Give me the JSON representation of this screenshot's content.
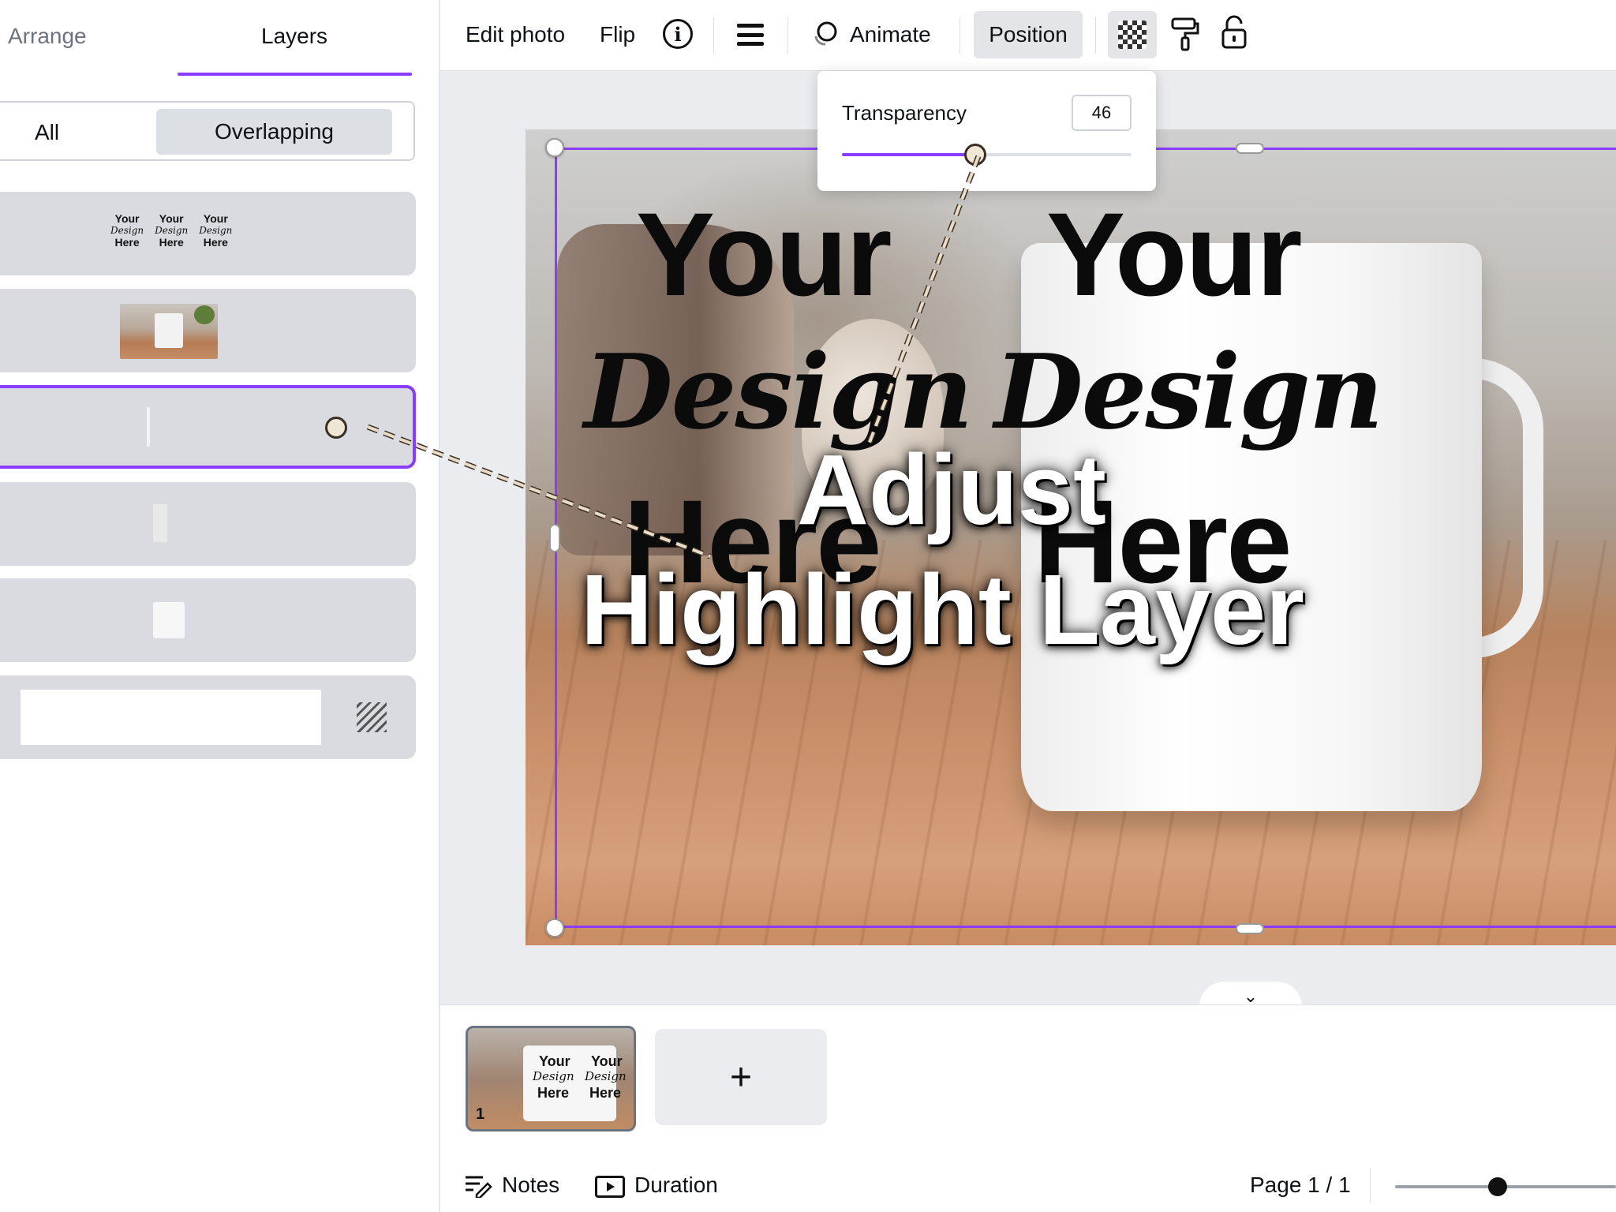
{
  "left_panel": {
    "tabs": [
      {
        "label": "Arrange"
      },
      {
        "label": "Layers"
      }
    ],
    "active_tab": "Layers",
    "filters": [
      {
        "label": "All"
      },
      {
        "label": "Overlapping"
      }
    ],
    "active_filter": "Overlapping",
    "layer_thumb_text": {
      "top": "Your",
      "script": "Design",
      "bottom": "Here"
    }
  },
  "toolbar": {
    "edit_photo": "Edit photo",
    "flip": "Flip",
    "info": "i",
    "animate": "Animate",
    "position": "Position"
  },
  "transparency": {
    "label": "Transparency",
    "value": "46",
    "level_percent": 46
  },
  "canvas": {
    "mug_text": {
      "top": "Your",
      "script": "Design",
      "bottom": "Here"
    },
    "caption_line1": "Adjust",
    "caption_line2": "Highlight Layer"
  },
  "pages": {
    "page_number": "1",
    "add_symbol": "+",
    "thumb_text": {
      "top": "Your",
      "script": "Design",
      "bottom": "Here"
    }
  },
  "footer": {
    "notes": "Notes",
    "duration": "Duration",
    "page_indicator": "Page 1 / 1",
    "collapse_symbol": "⌄"
  },
  "icons": {
    "info": "info-icon",
    "position_menu": "lines-icon",
    "animate": "animate-icon",
    "transparency": "checkerboard-icon",
    "copy_style": "paint-roller-icon",
    "lock": "lock-icon",
    "notes": "notes-icon",
    "duration": "play-icon"
  },
  "colors": {
    "accent": "#8b3dff",
    "canvas_bg": "#ebecf0"
  }
}
